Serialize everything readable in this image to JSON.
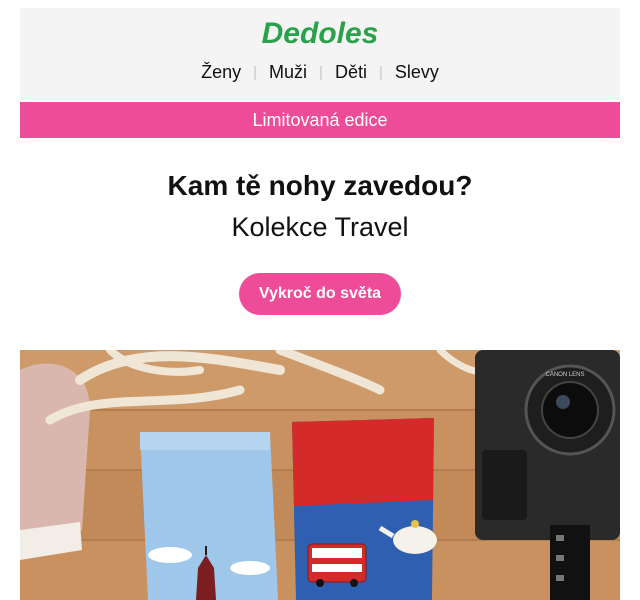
{
  "brand": {
    "logo_text": "Dedoles",
    "logo_color": "#2aa14a"
  },
  "nav": {
    "items": [
      {
        "label": "Ženy"
      },
      {
        "label": "Muži"
      },
      {
        "label": "Děti"
      },
      {
        "label": "Slevy"
      }
    ]
  },
  "banner": {
    "text": "Limitovaná edice",
    "color": "#ee4c98"
  },
  "hero": {
    "headline": "Kam tě nohy zavedou?",
    "subheadline": "Kolekce Travel",
    "cta_label": "Vykroč do světa"
  },
  "photo": {
    "camera_lens_text": "CANON LENS"
  }
}
